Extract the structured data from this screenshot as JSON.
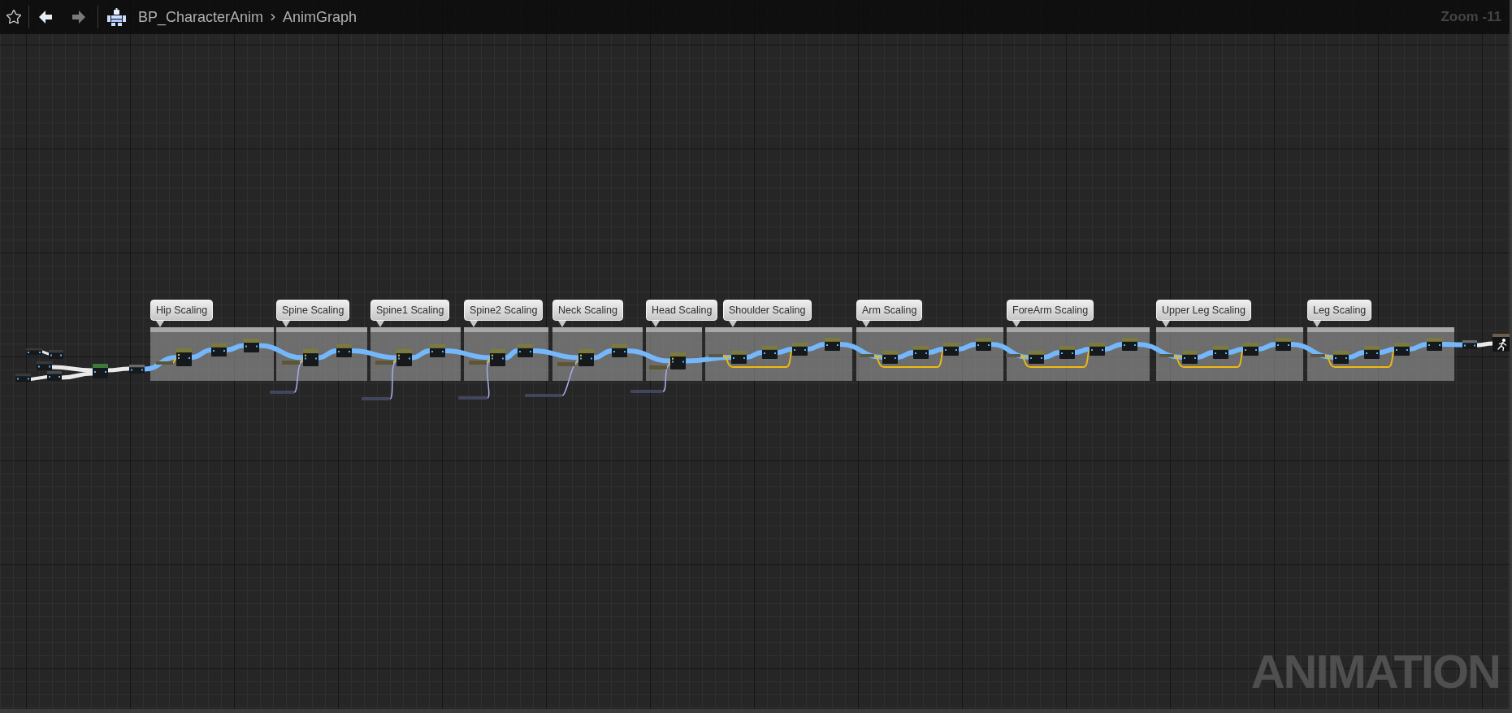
{
  "toolbar": {
    "back_button": {
      "disabled": false
    },
    "forward_button": {
      "disabled": true
    },
    "breadcrumb": [
      {
        "label": "BP_CharacterAnim"
      },
      {
        "label": "AnimGraph"
      }
    ],
    "zoom_label": "Zoom -11"
  },
  "graph": {
    "comments": [
      {
        "title": "Hip Scaling"
      },
      {
        "title": "Spine Scaling"
      },
      {
        "title": "Spine1 Scaling"
      },
      {
        "title": "Spine2 Scaling"
      },
      {
        "title": "Neck Scaling"
      },
      {
        "title": "Head Scaling"
      },
      {
        "title": "Shoulder Scaling"
      },
      {
        "title": "Arm Scaling"
      },
      {
        "title": "ForeArm Scaling"
      },
      {
        "title": "Upper Leg Scaling"
      },
      {
        "title": "Leg Scaling"
      }
    ]
  },
  "graph_type_label": "ANIMATION"
}
